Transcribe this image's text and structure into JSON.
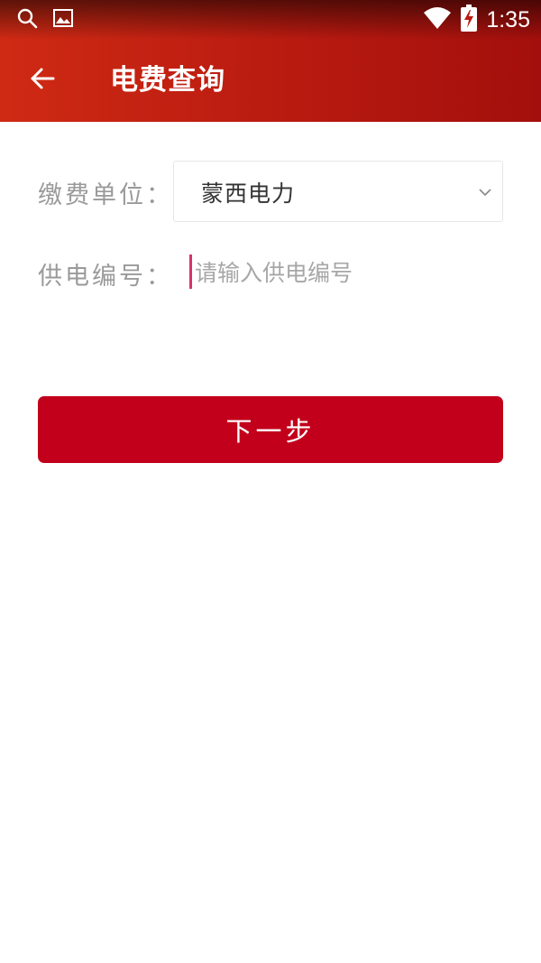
{
  "status_bar": {
    "time": "1:35",
    "left_icons": [
      "search-icon",
      "image-icon"
    ],
    "right_icons": [
      "wifi-icon",
      "battery-charging-icon"
    ]
  },
  "toolbar": {
    "title": "电费查询",
    "back_icon": "arrow-left-icon"
  },
  "form": {
    "unit_label": "缴费单位：",
    "unit_value": "蒙西电力",
    "supply_label": "供电编号：",
    "supply_placeholder": "请输入供电编号",
    "supply_value": ""
  },
  "actions": {
    "next_label": "下一步"
  },
  "colors": {
    "header": "#b81a10",
    "button": "#c2001b",
    "caret": "#d6336c"
  }
}
